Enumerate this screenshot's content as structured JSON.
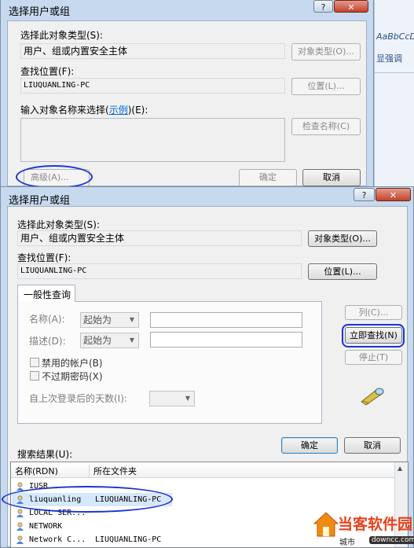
{
  "back_dialog": {
    "title": "选择用户或组",
    "help_btn": "?",
    "close_btn": "✕",
    "object_type_label": "选择此对象类型(S):",
    "object_type_value": "用户、组或内置安全主体",
    "object_types_btn": "对象类型(O)...",
    "location_label": "查找位置(F):",
    "location_value": "LIUQUANLING-PC",
    "locations_btn": "位置(L)...",
    "enter_names_label_pre": "输入对象名称来选择(",
    "enter_names_link": "示例",
    "enter_names_label_post": ")(E):",
    "check_names_btn": "检查名称(C)",
    "advanced_btn": "高级(A)...",
    "ok_btn": "确定",
    "cancel_btn": "取消"
  },
  "side_strip": {
    "text1": "AaBbCcDd",
    "text2": "显强调"
  },
  "front_dialog": {
    "title": "选择用户或组",
    "help_btn": "?",
    "close_btn": "✕",
    "object_type_label": "选择此对象类型(S):",
    "object_type_value": "用户、组或内置安全主体",
    "object_types_btn": "对象类型(O)...",
    "location_label": "查找位置(F):",
    "location_value": "LIUQUANLING-PC",
    "locations_btn": "位置(L)...",
    "tab_label": "一般性查询",
    "name_label": "名称(A):",
    "name_combo": "起始为",
    "desc_label": "描述(D):",
    "desc_combo": "起始为",
    "disabled_accounts": "禁用的帐户(B)",
    "non_expiring": "不过期密码(X)",
    "days_since_login": "自上次登录后的天数(I):",
    "columns_btn": "列(C)...",
    "find_now_btn": "立即查找(N)",
    "stop_btn": "停止(T)",
    "search_results_label": "搜索结果(U):",
    "ok_btn": "确定",
    "cancel_btn": "取消",
    "results_columns": [
      "名称(RDN)",
      "所在文件夹"
    ],
    "results": [
      {
        "name": "IUSR",
        "folder": ""
      },
      {
        "name": "liuquanling",
        "folder": "LIUQUANLING-PC"
      },
      {
        "name": "LOCAL SER...",
        "folder": ""
      },
      {
        "name": "NETWORK",
        "folder": ""
      },
      {
        "name": "Network C...",
        "folder": "LIUQUANLING-PC"
      }
    ]
  },
  "watermark": {
    "brand": "当客软件园",
    "sub": "城市",
    "url": "downcc.com"
  },
  "colors": {
    "annotation": "#1a34d6",
    "selection": "#3399ff",
    "title_bar": "#c6d9ee"
  }
}
